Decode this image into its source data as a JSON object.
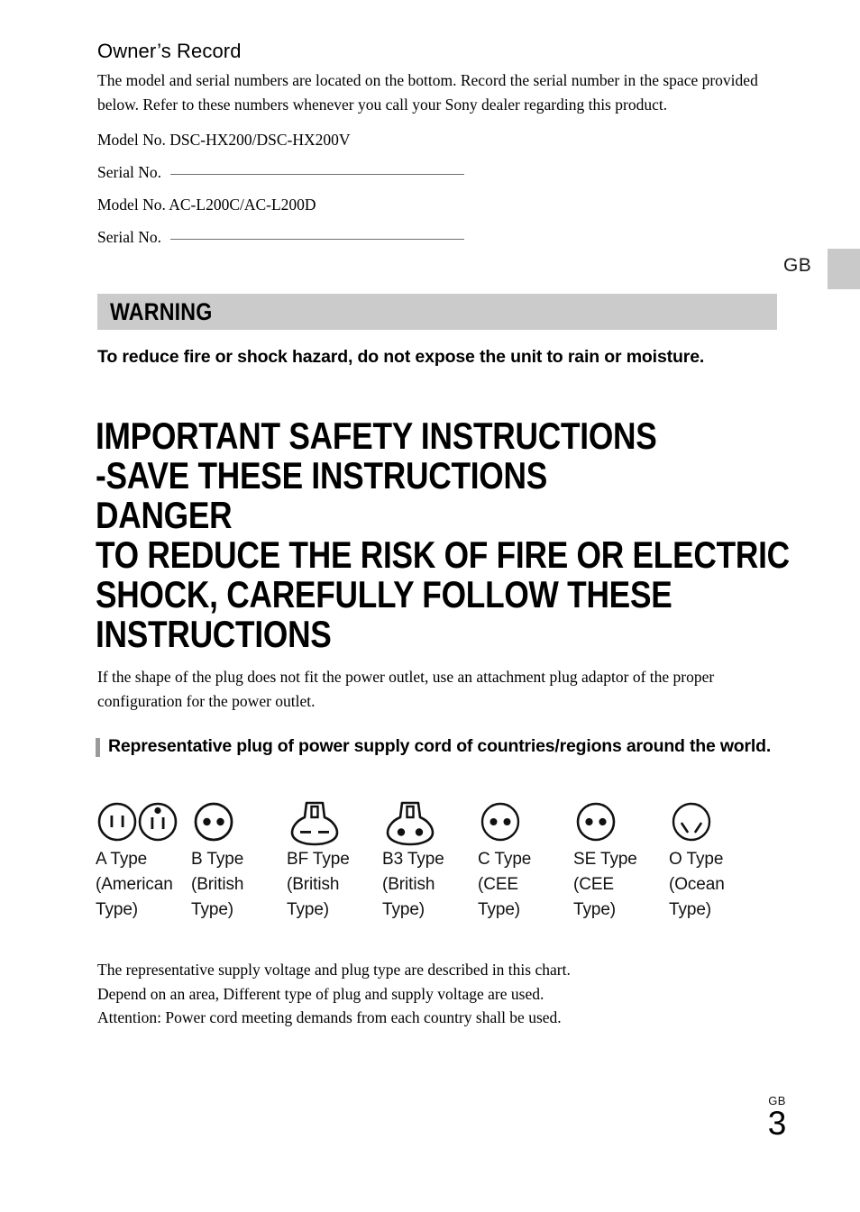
{
  "owners_record": {
    "title": "Owner’s Record",
    "intro": "The model and serial numbers are located on the bottom. Record the serial number in the space provided below. Refer to these numbers whenever you call your Sony dealer regarding this product.",
    "model_line_1": "Model No. DSC-HX200/DSC-HX200V",
    "serial_label_1": "Serial No.",
    "model_line_2": "Model No. AC-L200C/AC-L200D",
    "serial_label_2": "Serial No."
  },
  "edge": {
    "language_marker": "GB",
    "tab_color": "#c9c9c9"
  },
  "warning": {
    "band_label": "WARNING",
    "band_color": "#cbcbcb",
    "subtext": "To reduce fire or shock hazard, do not expose the unit to rain or moisture."
  },
  "headline": {
    "lines": [
      "IMPORTANT SAFETY INSTRUCTIONS",
      "-SAVE THESE INSTRUCTIONS",
      "DANGER",
      "TO REDUCE THE RISK OF FIRE OR ELECTRIC",
      "SHOCK, CAREFULLY FOLLOW THESE",
      "INSTRUCTIONS"
    ]
  },
  "plug_intro": "If the shape of the plug does not fit the power outlet, use an attachment plug adaptor of the proper configuration for the power outlet.",
  "bullet_heading": "Representative plug of power supply cord of countries/regions around the world.",
  "plug_types": [
    {
      "icon": "plug-a-type-icon",
      "label": "A Type\n(American\nType)"
    },
    {
      "icon": "plug-b-type-icon",
      "label": "B Type\n(British\nType)"
    },
    {
      "icon": "plug-bf-type-icon",
      "label": "BF Type\n(British\nType)"
    },
    {
      "icon": "plug-b3-type-icon",
      "label": "B3 Type\n(British\nType)"
    },
    {
      "icon": "plug-c-type-icon",
      "label": "C Type\n(CEE\nType)"
    },
    {
      "icon": "plug-se-type-icon",
      "label": "SE Type\n(CEE\nType)"
    },
    {
      "icon": "plug-o-type-icon",
      "label": "O Type\n(Ocean\nType)"
    }
  ],
  "closing": {
    "line_1": "The representative supply voltage and plug type are described in this chart.",
    "line_2": "Depend on an area, Different type of plug and supply voltage are used.",
    "line_3": "Attention: Power cord meeting demands from each country shall be used."
  },
  "footer": {
    "language": "GB",
    "page_number": "3"
  }
}
